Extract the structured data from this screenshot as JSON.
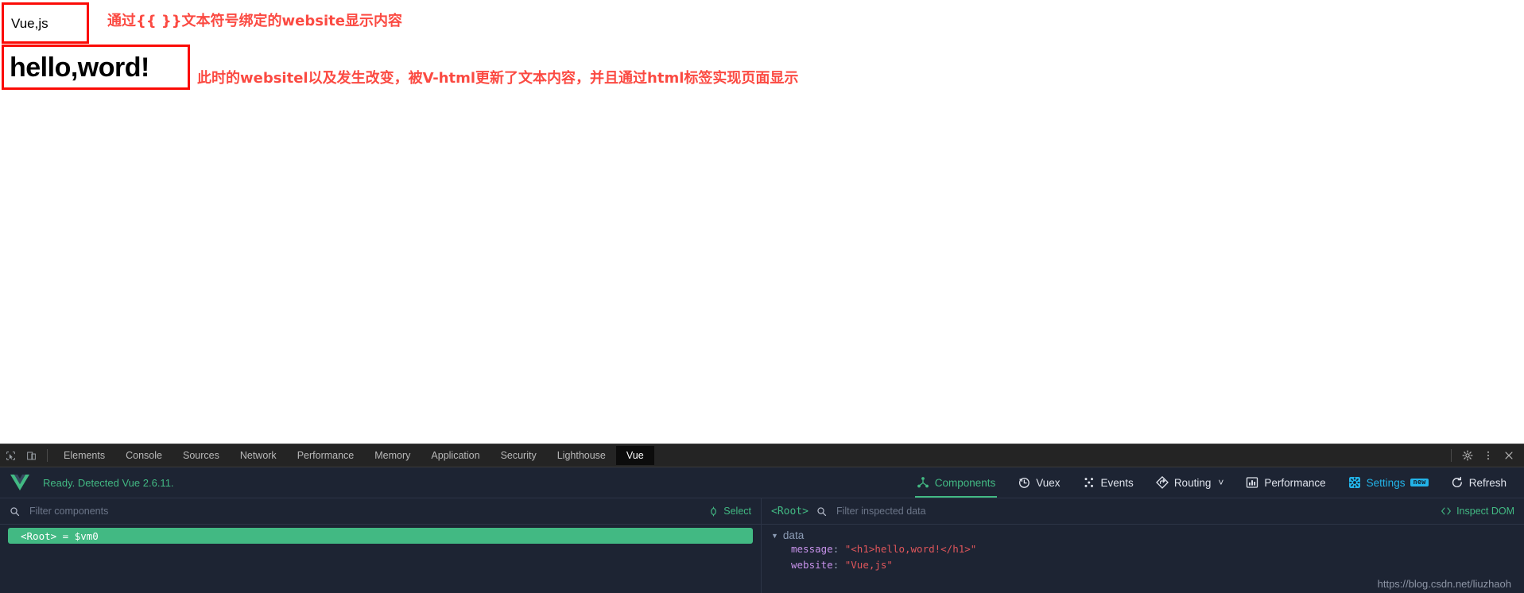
{
  "page": {
    "website_box_text": "Vue,js",
    "message_box_text": "hello,word!",
    "annotation_1": "通过{{ }}文本符号绑定的website显示内容",
    "annotation_2": "此时的websitel以及发生改变，被V-html更新了文本内容，并且通过html标签实现页面显示",
    "annotation_color": "#fb4a42",
    "box_border_color": "#fb0b06"
  },
  "devtools": {
    "tabs": [
      {
        "label": "Elements",
        "active": false
      },
      {
        "label": "Console",
        "active": false
      },
      {
        "label": "Sources",
        "active": false
      },
      {
        "label": "Network",
        "active": false
      },
      {
        "label": "Performance",
        "active": false
      },
      {
        "label": "Memory",
        "active": false
      },
      {
        "label": "Application",
        "active": false
      },
      {
        "label": "Security",
        "active": false
      },
      {
        "label": "Lighthouse",
        "active": false
      },
      {
        "label": "Vue",
        "active": true
      }
    ],
    "left_icons": [
      "inspect-element-icon",
      "device-toolbar-icon"
    ],
    "right_icons": [
      "gear-icon",
      "kebab-menu-icon",
      "close-icon"
    ]
  },
  "vue_devtools": {
    "status": "Ready. Detected Vue 2.6.11.",
    "logo": "vue-logo-icon",
    "nav": [
      {
        "label": "Components",
        "icon": "components-icon",
        "active": true
      },
      {
        "label": "Vuex",
        "icon": "vuex-clock-icon",
        "active": false
      },
      {
        "label": "Events",
        "icon": "events-icon",
        "active": false
      },
      {
        "label": "Routing",
        "icon": "routing-icon",
        "active": false,
        "chevron": "˅"
      },
      {
        "label": "Performance",
        "icon": "performance-bars-icon",
        "active": false
      },
      {
        "label": "Settings",
        "icon": "settings-gear-icon",
        "active": false,
        "badge": "new"
      },
      {
        "label": "Refresh",
        "icon": "refresh-icon",
        "active": false
      }
    ],
    "accent_green": "#42b983",
    "accent_cyan": "#23b3e8",
    "components_pane": {
      "filter_placeholder": "Filter components",
      "filter_value": "",
      "select_label": "Select",
      "tree": [
        {
          "label": "<Root> = $vm0",
          "selected": true
        }
      ]
    },
    "inspector_pane": {
      "root_label": "<Root>",
      "filter_placeholder": "Filter inspected data",
      "filter_value": "",
      "inspect_dom_label": "Inspect DOM",
      "groups": [
        {
          "name": "data",
          "expanded": true,
          "props": [
            {
              "key": "message",
              "value": "\"<h1>hello,word!</h1>\""
            },
            {
              "key": "website",
              "value": "\"Vue,js\""
            }
          ]
        }
      ]
    }
  },
  "watermark": "https://blog.csdn.net/liuzhaoh"
}
